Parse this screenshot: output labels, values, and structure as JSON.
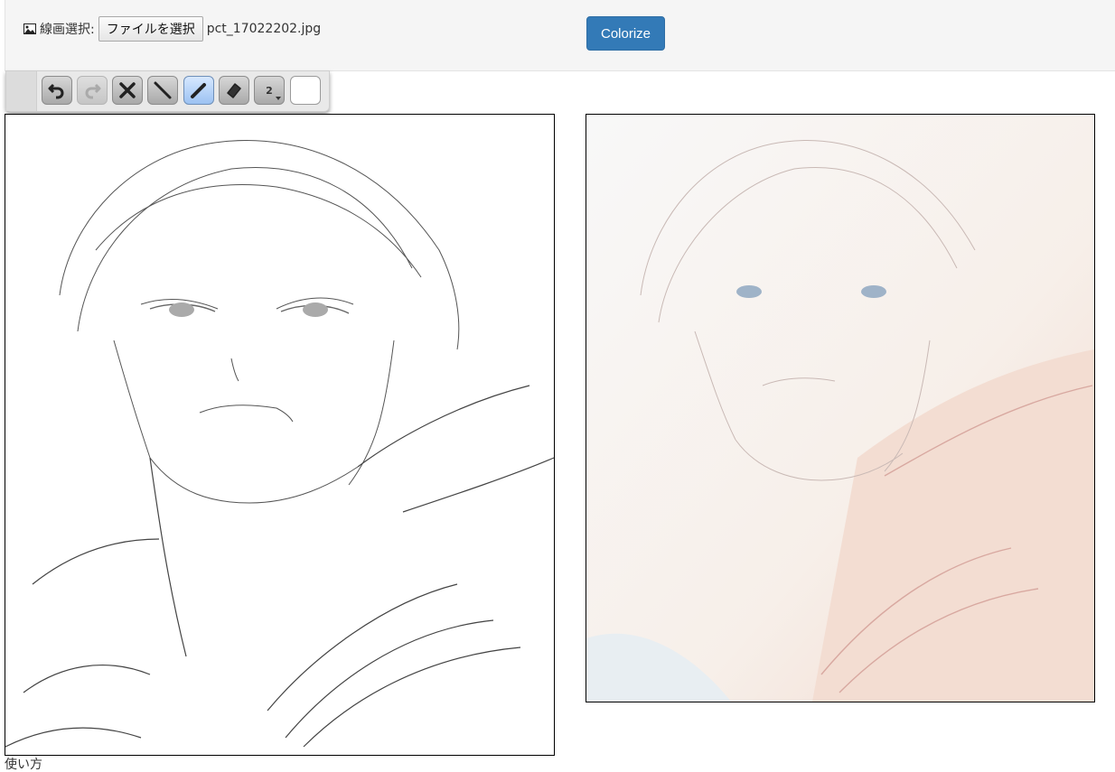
{
  "header": {
    "line_label": "線画選択:",
    "file_button_label": "ファイルを選択",
    "file_name": "pct_17022202.jpg",
    "colorize_label": "Colorize"
  },
  "toolbar": {
    "tools": [
      {
        "name": "undo-icon",
        "state": "normal"
      },
      {
        "name": "redo-icon",
        "state": "disabled"
      },
      {
        "name": "clear-icon",
        "state": "normal"
      },
      {
        "name": "line-icon",
        "state": "normal"
      },
      {
        "name": "pencil-icon",
        "state": "active"
      },
      {
        "name": "eraser-icon",
        "state": "normal"
      },
      {
        "name": "size-icon",
        "state": "normal",
        "value": "2"
      },
      {
        "name": "color-swatch",
        "state": "normal",
        "color": "#ffffff"
      }
    ]
  },
  "footer": {
    "text": "使い方"
  },
  "colors": {
    "accent": "#337ab7",
    "topbar_bg": "#f5f5f5",
    "active_tool": "#9cc2f2"
  }
}
